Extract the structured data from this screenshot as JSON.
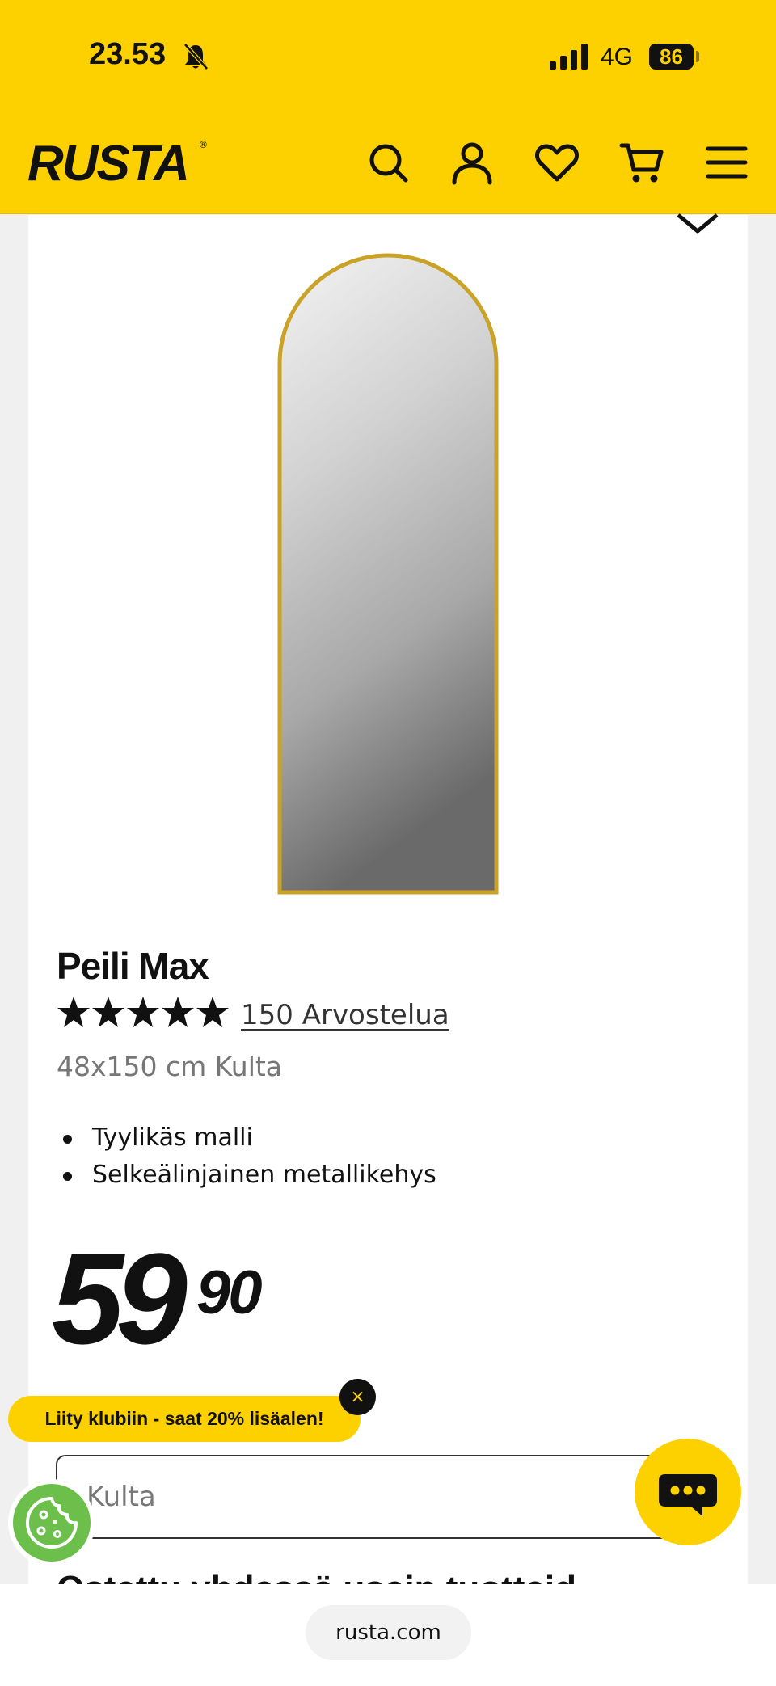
{
  "status_bar": {
    "time": "23.53",
    "network": "4G",
    "battery": "86"
  },
  "header": {
    "logo": "RUSTA",
    "logo_mark": "®"
  },
  "product": {
    "title": "Peili Max",
    "rating": 5,
    "reviews": "150 Arvostelua",
    "variant": "48x150 cm Kulta",
    "features": [
      "Tyylikäs malli",
      "Selkeälinjainen metallikehys"
    ],
    "price_main": "59",
    "price_decimal": "90",
    "selected_variant": "Kulta",
    "next_heading": "Ostettu yhdessä usein tuotteiden kanssa"
  },
  "promo": {
    "text": "Liity klubiin - saat 20% lisäalen!",
    "close": "×"
  },
  "browser": {
    "url": "rusta.com"
  },
  "colors": {
    "brand_yellow": "#fdd100",
    "cookie_green": "#6cbf4a",
    "mirror_frame": "#c9a227"
  },
  "icons": [
    "bell-off-icon",
    "signal-icon",
    "search-icon",
    "user-icon",
    "heart-icon",
    "cart-icon",
    "menu-icon",
    "star-icon",
    "cookie-icon",
    "chat-icon"
  ]
}
